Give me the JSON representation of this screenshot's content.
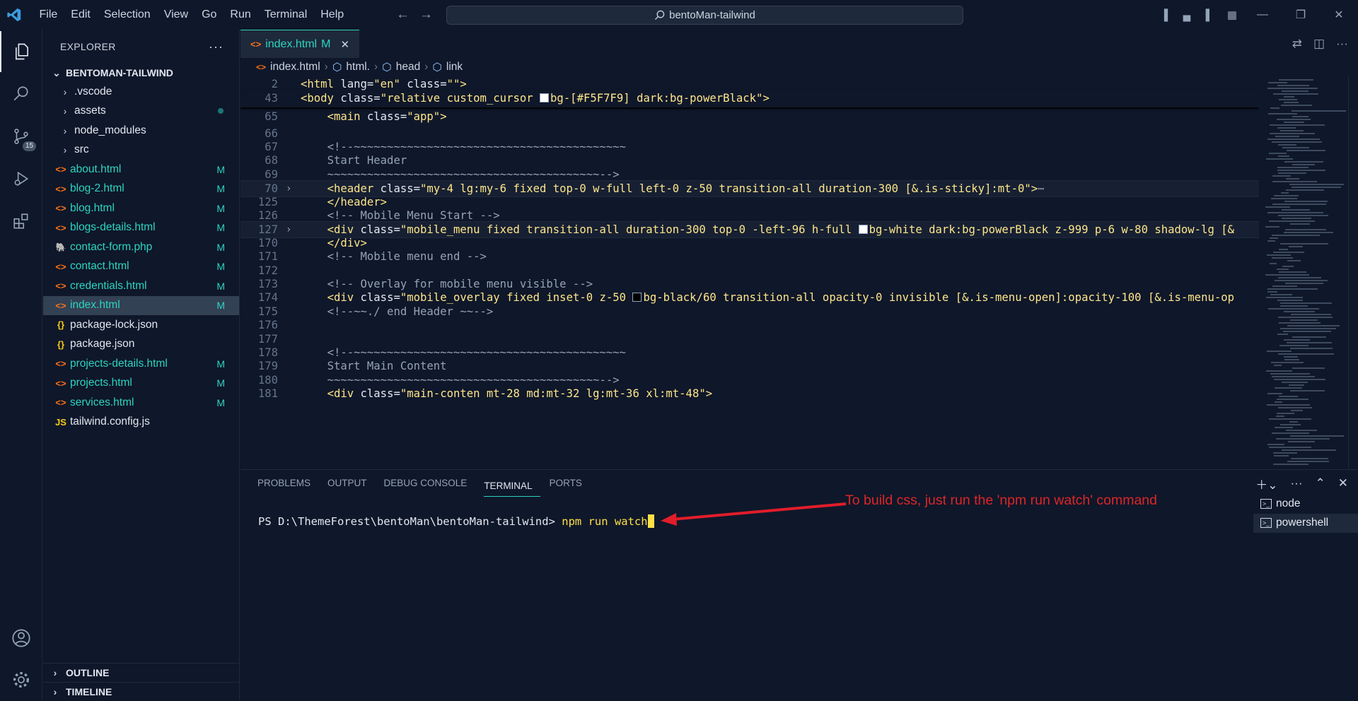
{
  "window": {
    "search": "bentoMan-tailwind"
  },
  "menu": [
    "File",
    "Edit",
    "Selection",
    "View",
    "Go",
    "Run",
    "Terminal",
    "Help"
  ],
  "activity": {
    "scm_badge": "15"
  },
  "explorer": {
    "header": "EXPLORER",
    "folder": "BENTOMAN-TAILWIND",
    "items": [
      {
        "name": ".vscode",
        "type": "folder",
        "status": ""
      },
      {
        "name": "assets",
        "type": "folder",
        "status": "dot"
      },
      {
        "name": "node_modules",
        "type": "folder",
        "status": ""
      },
      {
        "name": "src",
        "type": "folder",
        "status": ""
      },
      {
        "name": "about.html",
        "type": "html",
        "status": "M"
      },
      {
        "name": "blog-2.html",
        "type": "html",
        "status": "M"
      },
      {
        "name": "blog.html",
        "type": "html",
        "status": "M"
      },
      {
        "name": "blogs-details.html",
        "type": "html",
        "status": "M"
      },
      {
        "name": "contact-form.php",
        "type": "php",
        "status": "M"
      },
      {
        "name": "contact.html",
        "type": "html",
        "status": "M"
      },
      {
        "name": "credentials.html",
        "type": "html",
        "status": "M"
      },
      {
        "name": "index.html",
        "type": "html",
        "status": "M"
      },
      {
        "name": "package-lock.json",
        "type": "json",
        "status": ""
      },
      {
        "name": "package.json",
        "type": "json",
        "status": ""
      },
      {
        "name": "projects-details.html",
        "type": "html",
        "status": "M"
      },
      {
        "name": "projects.html",
        "type": "html",
        "status": "M"
      },
      {
        "name": "services.html",
        "type": "html",
        "status": "M"
      },
      {
        "name": "tailwind.config.js",
        "type": "js",
        "status": ""
      }
    ],
    "outline": "OUTLINE",
    "timeline": "TIMELINE"
  },
  "editor": {
    "tab": {
      "name": "index.html",
      "status": "M"
    },
    "breadcrumb": [
      "index.html",
      "html.",
      "head",
      "link"
    ]
  },
  "panel": {
    "tabs": [
      "PROBLEMS",
      "OUTPUT",
      "DEBUG CONSOLE",
      "TERMINAL",
      "PORTS"
    ],
    "prompt": "PS D:\\ThemeForest\\bentoMan\\bentoMan-tailwind> ",
    "command": "npm run watch",
    "annotation": "To build css, just run the 'npm run watch' command",
    "terminals": [
      "node",
      "powershell"
    ]
  },
  "colors": {
    "accent": "#2dd4bf",
    "annotation": "#dc2626"
  }
}
